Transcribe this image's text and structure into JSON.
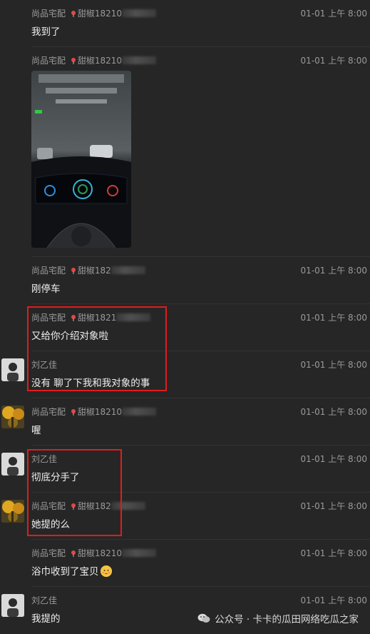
{
  "messages": [
    {
      "sender": "尚品宅配",
      "nick": "甜椒18210",
      "time": "01-01 上午 8:00",
      "text": "我到了"
    },
    {
      "sender": "尚品宅配",
      "nick": "甜椒18210",
      "time": "01-01 上午 8:00",
      "text": ""
    },
    {
      "sender": "尚品宅配",
      "nick": "甜椒182",
      "time": "01-01 上午 8:00",
      "text": "刚停车"
    },
    {
      "sender": "尚品宅配",
      "nick": "甜椒1821",
      "time": "01-01 上午 8:00",
      "text": "又给你介绍对象啦"
    },
    {
      "sender": "刘乙佳",
      "nick": "",
      "time": "01-01 上午 8:00",
      "text": "没有 聊了下我和我对象的事"
    },
    {
      "sender": "尚品宅配",
      "nick": "甜椒18210",
      "time": "01-01 上午 8:00",
      "text": "喔"
    },
    {
      "sender": "刘乙佳",
      "nick": "",
      "time": "01-01 上午 8:00",
      "text": "彻底分手了"
    },
    {
      "sender": "尚品宅配",
      "nick": "甜椒182",
      "time": "01-01 上午 8:00",
      "text": "她提的么"
    },
    {
      "sender": "尚品宅配",
      "nick": "甜椒18210",
      "time": "01-01 上午 8:00",
      "text": "浴巾收到了宝贝"
    },
    {
      "sender": "刘乙佳",
      "nick": "",
      "time": "01-01 上午 8:00",
      "text": "我提的"
    }
  ],
  "watermark": "公众号 · 卡卡的瓜田网络吃瓜之家",
  "colors": {
    "background": "#262626",
    "highlight": "#e11c1c"
  }
}
